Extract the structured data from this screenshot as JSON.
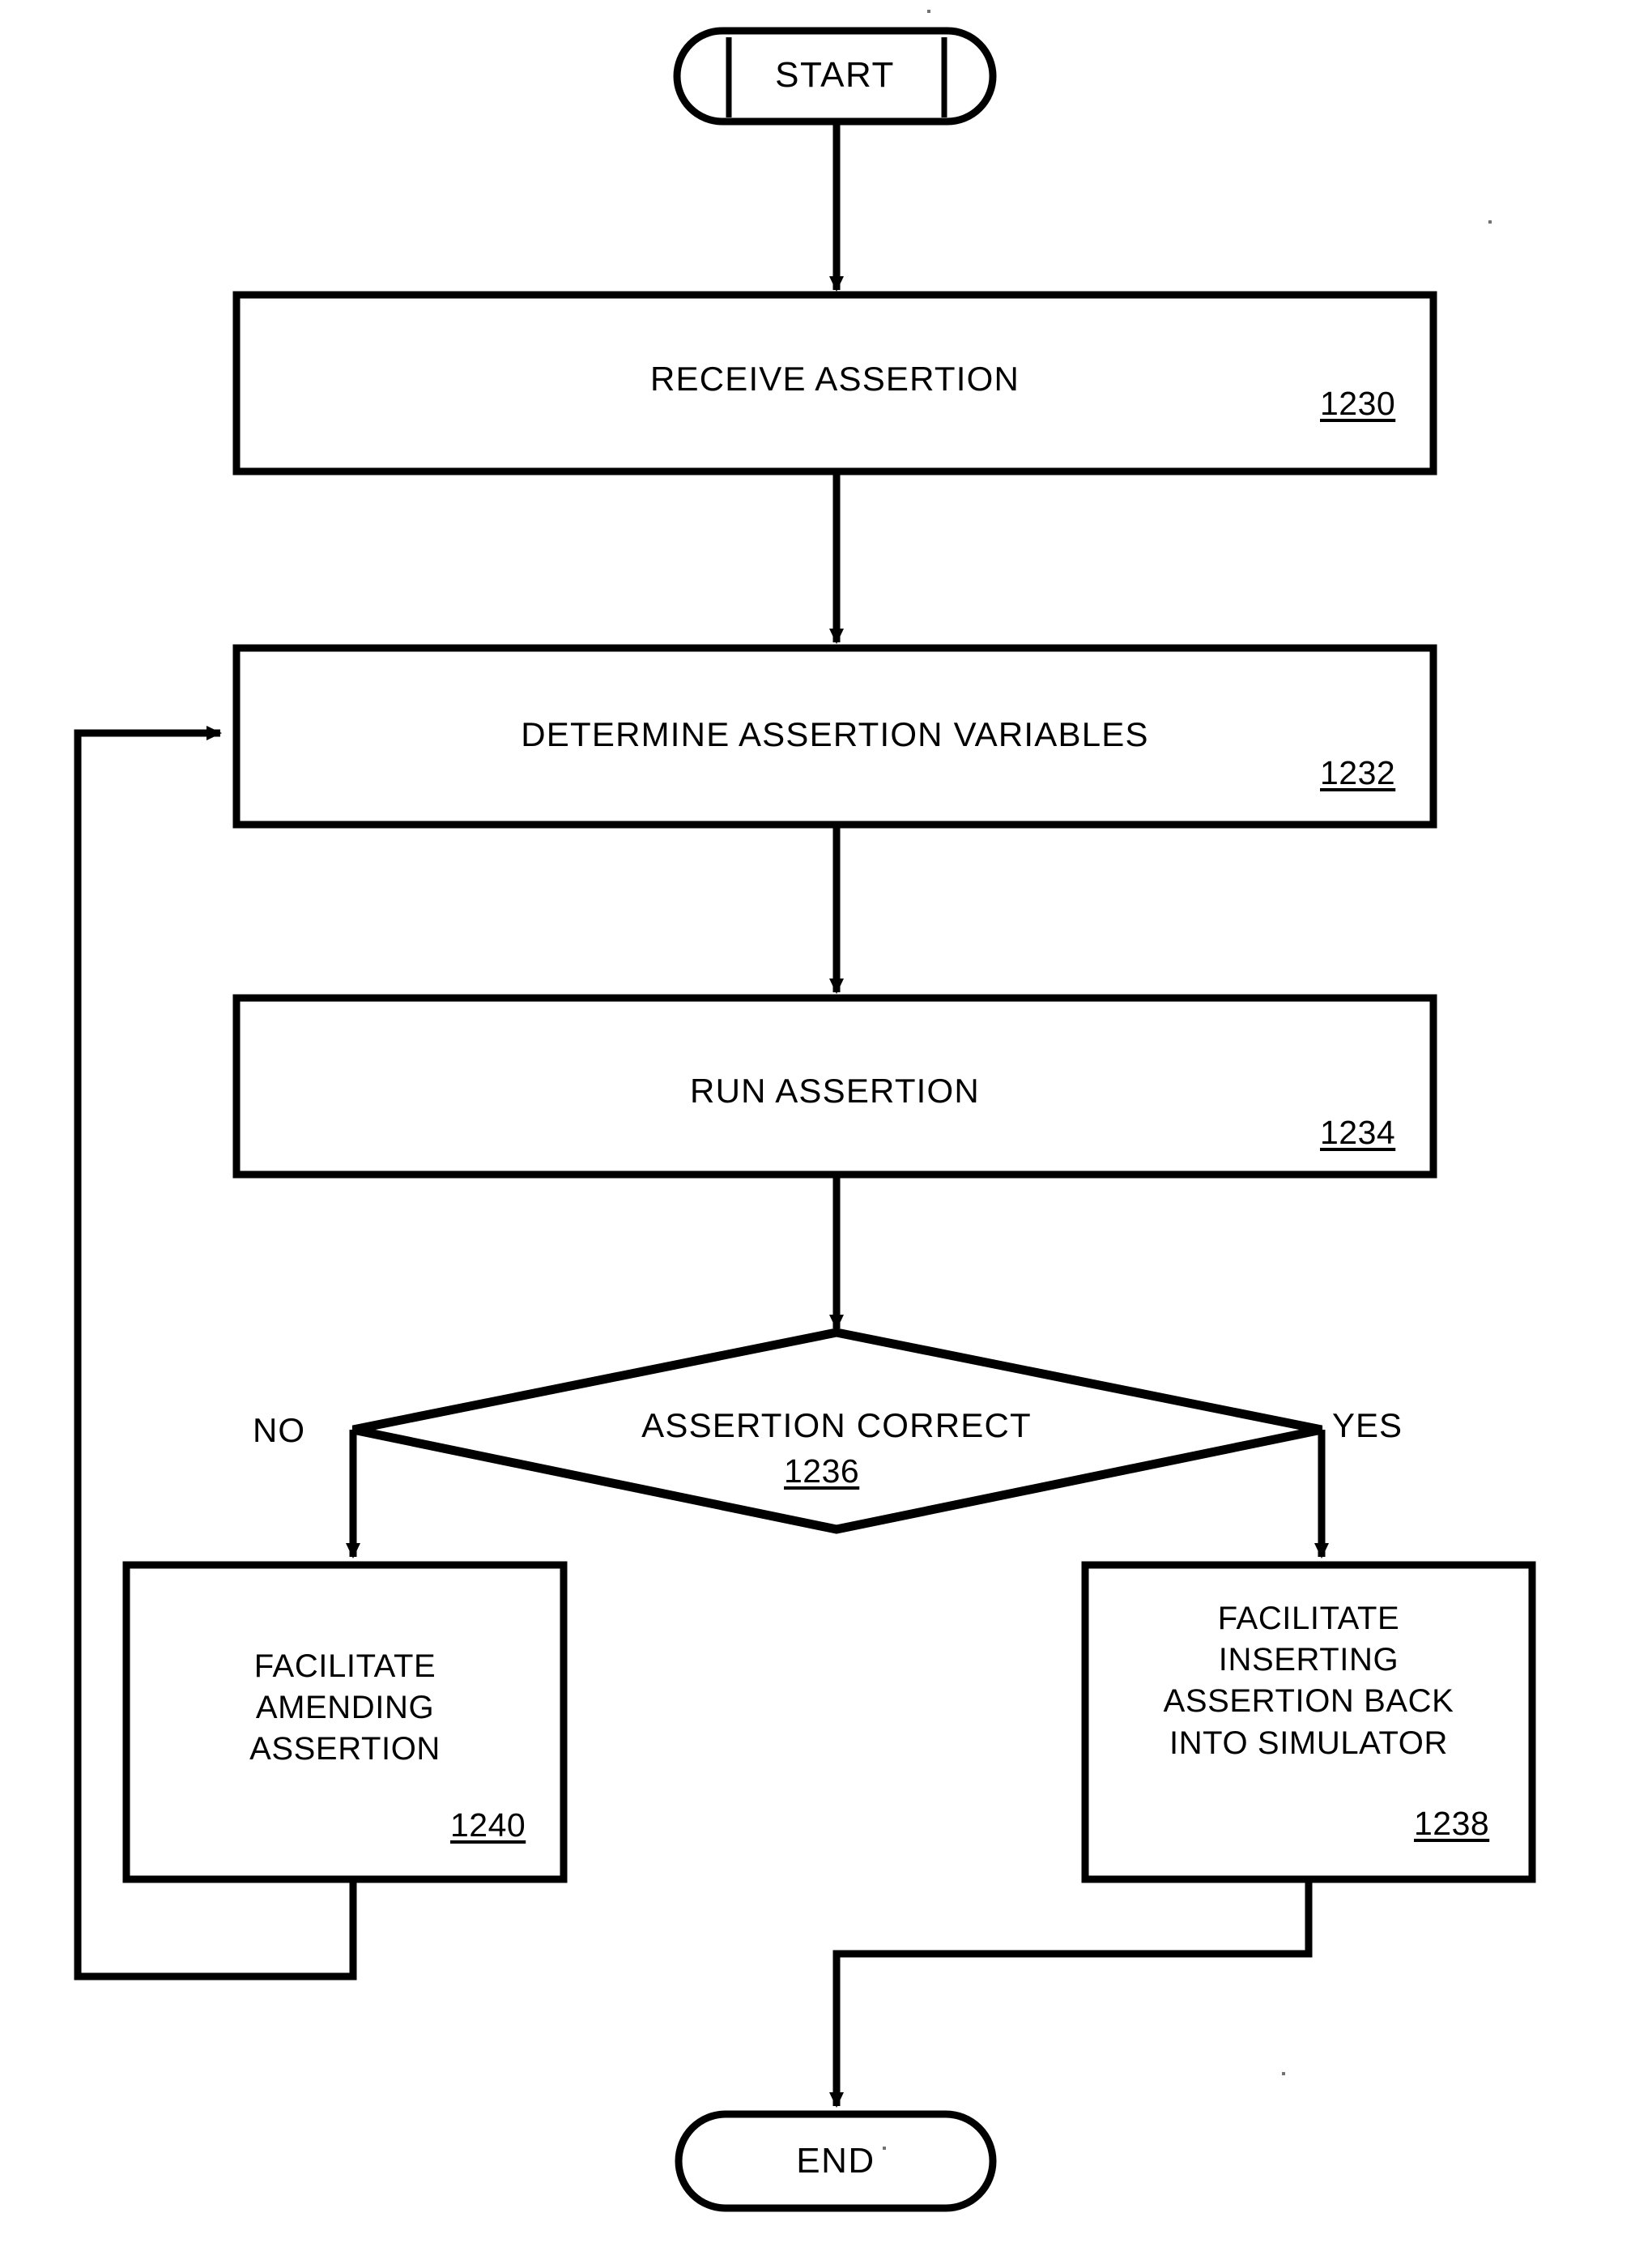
{
  "figure": {
    "type": "flowchart",
    "orientation": "top-to-bottom",
    "background_color": "#ffffff",
    "stroke_color": "#000000"
  },
  "nodes": {
    "start": {
      "shape": "terminator",
      "label": "START"
    },
    "receive_assertion": {
      "shape": "process",
      "label": "RECEIVE ASSERTION",
      "ref": "1230"
    },
    "determine_variables": {
      "shape": "process",
      "label": "DETERMINE ASSERTION VARIABLES",
      "ref": "1232"
    },
    "run_assertion": {
      "shape": "process",
      "label": "RUN ASSERTION",
      "ref": "1234"
    },
    "assertion_correct": {
      "shape": "decision",
      "label": "ASSERTION CORRECT",
      "ref": "1236"
    },
    "facilitate_amending": {
      "shape": "process",
      "label": "FACILITATE\nAMENDING\nASSERTION",
      "ref": "1240"
    },
    "facilitate_inserting": {
      "shape": "process",
      "label": "FACILITATE\nINSERTING\nASSERTION BACK\nINTO SIMULATOR",
      "ref": "1238"
    },
    "end": {
      "shape": "terminator",
      "label": "END"
    }
  },
  "branch_labels": {
    "no": "NO",
    "yes": "YES"
  },
  "edges": [
    {
      "from": "start",
      "to": "receive_assertion",
      "label": ""
    },
    {
      "from": "receive_assertion",
      "to": "determine_variables",
      "label": ""
    },
    {
      "from": "determine_variables",
      "to": "run_assertion",
      "label": ""
    },
    {
      "from": "run_assertion",
      "to": "assertion_correct",
      "label": ""
    },
    {
      "from": "assertion_correct",
      "to": "facilitate_amending",
      "label": "NO"
    },
    {
      "from": "assertion_correct",
      "to": "facilitate_inserting",
      "label": "YES"
    },
    {
      "from": "facilitate_amending",
      "to": "determine_variables",
      "label": ""
    },
    {
      "from": "facilitate_inserting",
      "to": "end",
      "label": ""
    }
  ]
}
